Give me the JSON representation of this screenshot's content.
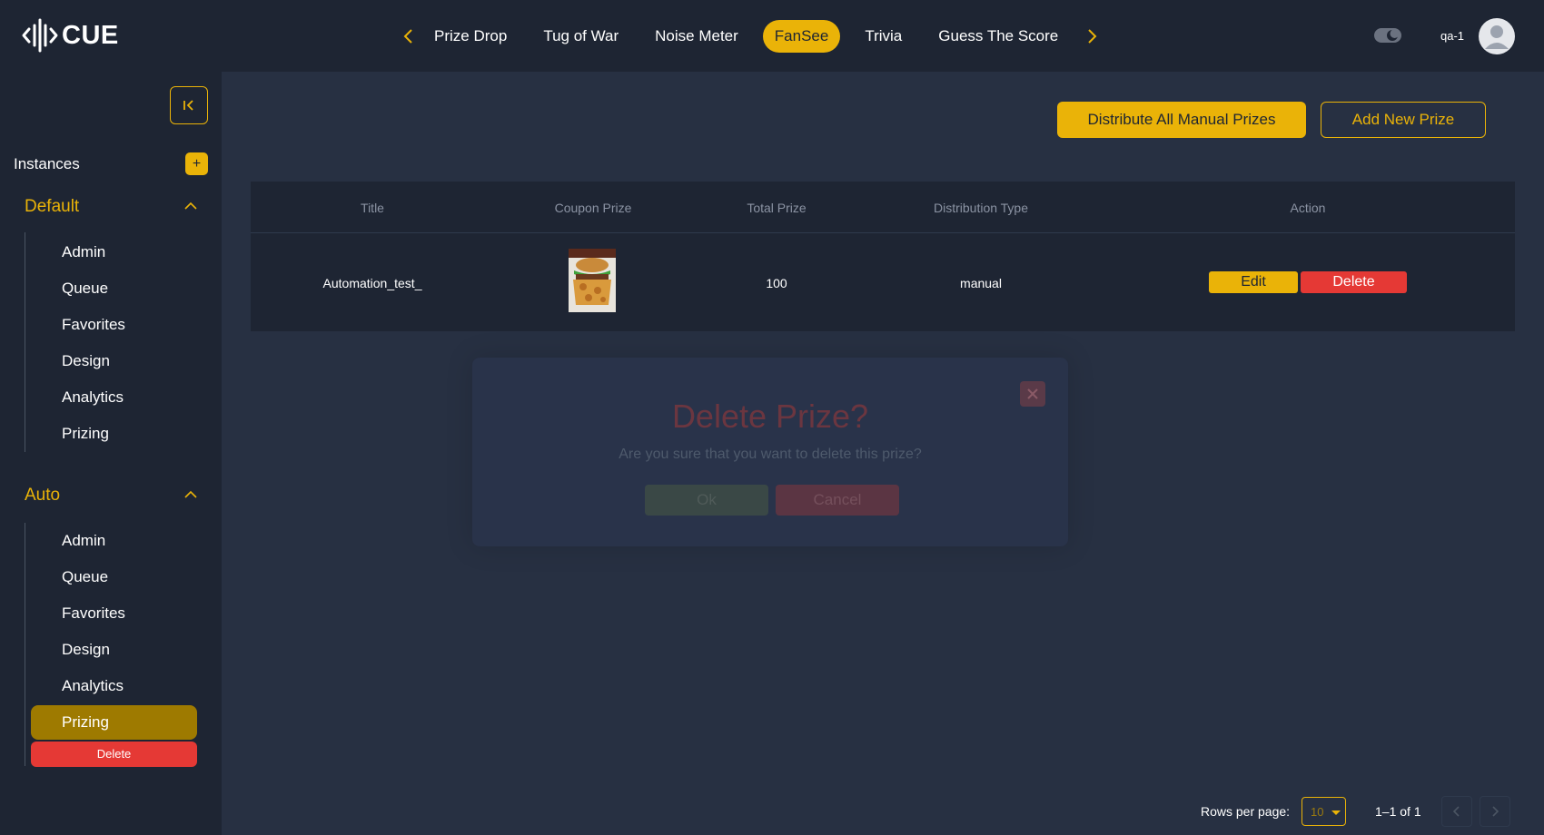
{
  "app": {
    "logo_text": "CUE"
  },
  "header": {
    "tabs": [
      {
        "label": "Prize Drop",
        "active": false
      },
      {
        "label": "Tug of War",
        "active": false
      },
      {
        "label": "Noise Meter",
        "active": false
      },
      {
        "label": "FanSee",
        "active": true
      },
      {
        "label": "Trivia",
        "active": false
      },
      {
        "label": "Guess The Score",
        "active": false
      }
    ],
    "username": "qa-1"
  },
  "sidebar": {
    "instances_label": "Instances",
    "add_instance_label": "+",
    "groups": [
      {
        "title": "Default",
        "items": [
          "Admin",
          "Queue",
          "Favorites",
          "Design",
          "Analytics",
          "Prizing"
        ]
      },
      {
        "title": "Auto",
        "items": [
          "Admin",
          "Queue",
          "Favorites",
          "Design",
          "Analytics",
          "Prizing"
        ],
        "active_item": "Prizing",
        "delete_label": "Delete"
      }
    ]
  },
  "main": {
    "distribute_label": "Distribute All Manual Prizes",
    "add_prize_label": "Add New Prize",
    "table": {
      "columns": [
        "Title",
        "Coupon Prize",
        "Total Prize",
        "Distribution Type",
        "Action"
      ],
      "rows": [
        {
          "title": "Automation_test_",
          "total_prize": "100",
          "distribution_type": "manual",
          "edit_label": "Edit",
          "delete_label": "Delete"
        }
      ]
    }
  },
  "modal": {
    "title": "Delete Prize?",
    "message": "Are you sure that you want to delete this prize?",
    "ok_label": "Ok",
    "cancel_label": "Cancel"
  },
  "pagination": {
    "rows_per_page_label": "Rows per page:",
    "rows_per_page_value": "10",
    "range_label": "1–1 of 1"
  },
  "colors": {
    "accent": "#eab308",
    "danger": "#e53935",
    "background": "#273042",
    "panel": "#1e2533"
  }
}
